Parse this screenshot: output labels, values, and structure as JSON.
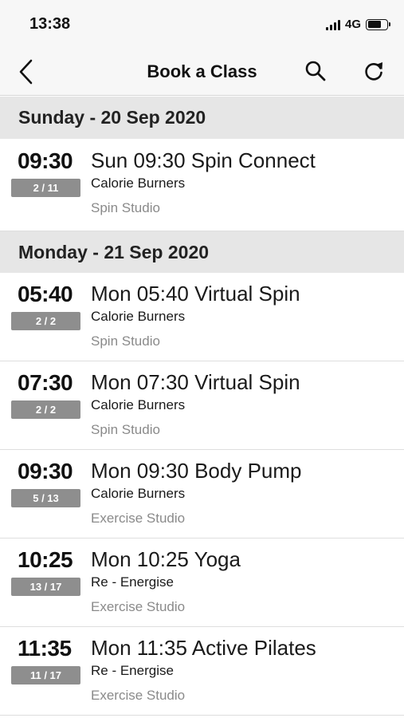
{
  "status": {
    "time": "13:38",
    "network": "4G"
  },
  "nav": {
    "title": "Book a Class",
    "icons": [
      "chevron-left-icon",
      "search-icon",
      "refresh-icon"
    ]
  },
  "days": [
    {
      "label": "Sunday - 20 Sep 2020",
      "classes": [
        {
          "time": "09:30",
          "capacity": "2 / 11",
          "name": "Sun 09:30 Spin Connect",
          "host": "Calorie Burners",
          "room": "Spin Studio"
        }
      ]
    },
    {
      "label": "Monday - 21 Sep 2020",
      "classes": [
        {
          "time": "05:40",
          "capacity": "2 / 2",
          "name": "Mon 05:40 Virtual Spin",
          "host": "Calorie Burners",
          "room": "Spin Studio"
        },
        {
          "time": "07:30",
          "capacity": "2 / 2",
          "name": "Mon 07:30 Virtual Spin",
          "host": "Calorie Burners",
          "room": "Spin Studio"
        },
        {
          "time": "09:30",
          "capacity": "5 / 13",
          "name": "Mon 09:30 Body Pump",
          "host": "Calorie Burners",
          "room": "Exercise Studio"
        },
        {
          "time": "10:25",
          "capacity": "13 / 17",
          "name": "Mon 10:25 Yoga",
          "host": "Re - Energise",
          "room": "Exercise Studio"
        },
        {
          "time": "11:35",
          "capacity": "11 / 17",
          "name": "Mon 11:35  Active Pilates",
          "host": "Re - Energise",
          "room": "Exercise Studio"
        }
      ]
    }
  ],
  "colors": {
    "header_bg": "#f7f7f7",
    "day_header_bg": "#e6e6e6",
    "badge_bg": "#8e8e8e",
    "secondary_text": "#8a8a8a"
  }
}
